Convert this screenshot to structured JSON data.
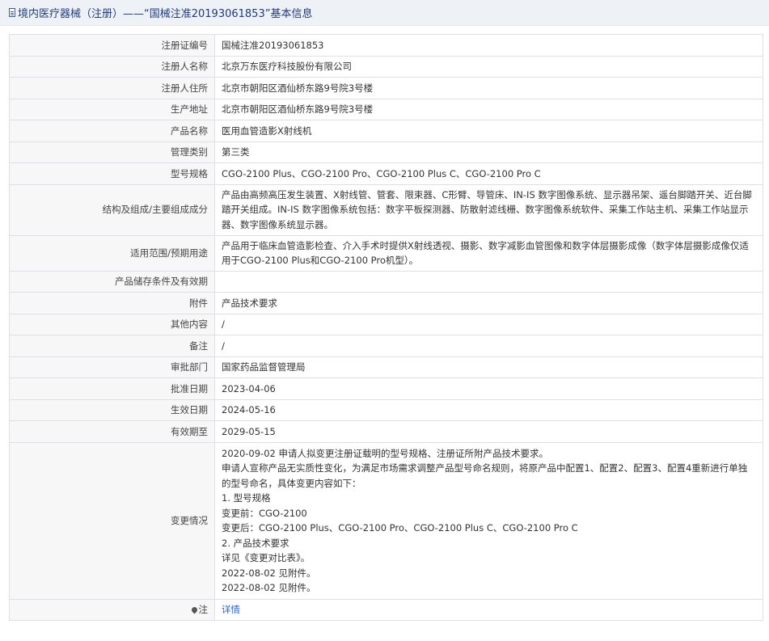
{
  "header": {
    "title": "境内医疗器械（注册）——“国械注准20193061853”基本信息"
  },
  "rows": {
    "reg_no": {
      "label": "注册证编号",
      "value": "国械注准20193061853"
    },
    "registrant": {
      "label": "注册人名称",
      "value": "北京万东医疗科技股份有限公司"
    },
    "residence": {
      "label": "注册人住所",
      "value": "北京市朝阳区酒仙桥东路9号院3号楼"
    },
    "production_address": {
      "label": "生产地址",
      "value": "北京市朝阳区酒仙桥东路9号院3号楼"
    },
    "product_name": {
      "label": "产品名称",
      "value": "医用血管造影X射线机"
    },
    "management_class": {
      "label": "管理类别",
      "value": "第三类"
    },
    "model_spec": {
      "label": "型号规格",
      "value": "CGO-2100 Plus、CGO-2100 Pro、CGO-2100 Plus C、CGO-2100 Pro C"
    },
    "structure": {
      "label": "结构及组成/主要组成成分",
      "value": "产品由高频高压发生装置、X射线管、管套、限束器、C形臂、导管床、IN-IS 数字图像系统、显示器吊架、遥台脚踏开关、近台脚踏开关组成。IN-IS 数字图像系统包括：数字平板探测器、防散射滤线栅、数字图像系统软件、采集工作站主机、采集工作站显示器、数字图像系统显示器。"
    },
    "intended_use": {
      "label": "适用范围/预期用途",
      "value": "产品用于临床血管造影检查、介入手术时提供X射线透视、摄影、数字减影血管图像和数字体层摄影成像（数字体层摄影成像仅适用于CGO-2100 Plus和CGO-2100 Pro机型）。"
    },
    "storage": {
      "label": "产品储存条件及有效期",
      "value": ""
    },
    "attachment": {
      "label": "附件",
      "value": "产品技术要求"
    },
    "other": {
      "label": "其他内容",
      "value": "/"
    },
    "remark": {
      "label": "备注",
      "value": "/"
    },
    "approval_dept": {
      "label": "审批部门",
      "value": "国家药品监督管理局"
    },
    "approval_date": {
      "label": "批准日期",
      "value": "2023-04-06"
    },
    "effective_date": {
      "label": "生效日期",
      "value": "2024-05-16"
    },
    "expiry_date": {
      "label": "有效期至",
      "value": "2029-05-15"
    },
    "changes": {
      "label": "变更情况",
      "lines": [
        "2020-09-02 申请人拟变更注册证载明的型号规格、注册证所附产品技术要求。",
        "申请人宣称产品无实质性变化，为满足市场需求调整产品型号命名规则，将原产品中配置1、配置2、配置3、配置4重新进行单独的型号命名，具体变更内容如下：",
        "1. 型号规格",
        "变更前：CGO-2100",
        "变更后：CGO-2100 Plus、CGO-2100 Pro、CGO-2100 Plus C、CGO-2100 Pro C",
        "2. 产品技术要求",
        "详见《变更对比表》。",
        "2022-08-02 见附件。",
        "2022-08-02 见附件。"
      ]
    },
    "note": {
      "label": "注",
      "icon": "pin-icon",
      "link_text": "详情"
    }
  }
}
